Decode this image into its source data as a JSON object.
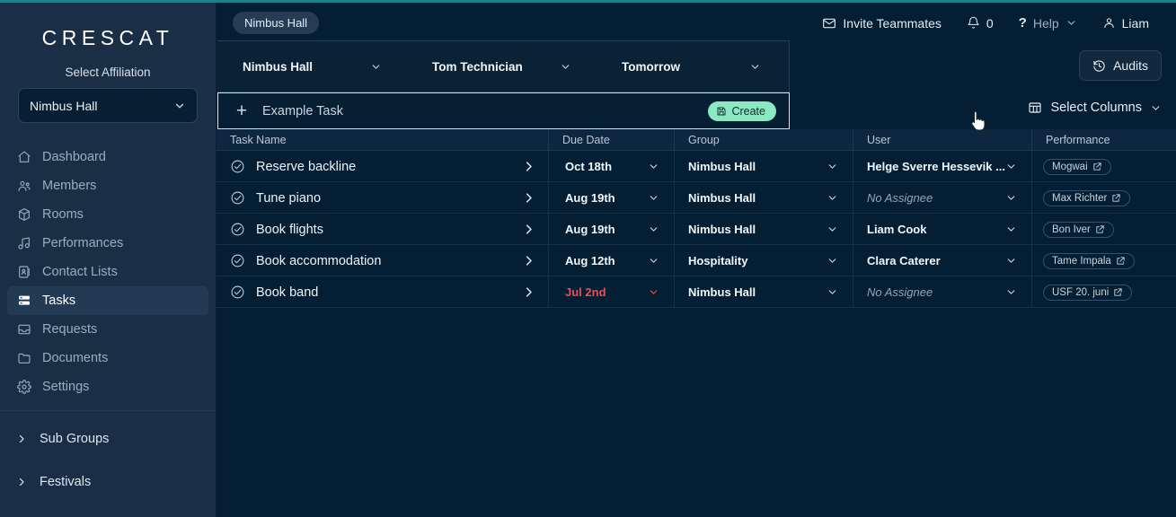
{
  "brand": "CRESCAT",
  "sidebar": {
    "affiliation_label": "Select Affiliation",
    "affiliation_value": "Nimbus Hall",
    "items": [
      {
        "label": "Dashboard",
        "icon": "home-icon",
        "active": false
      },
      {
        "label": "Members",
        "icon": "users-icon",
        "active": false
      },
      {
        "label": "Rooms",
        "icon": "cube-icon",
        "active": false
      },
      {
        "label": "Performances",
        "icon": "music-icon",
        "active": false
      },
      {
        "label": "Contact Lists",
        "icon": "contact-card-icon",
        "active": false
      },
      {
        "label": "Tasks",
        "icon": "tasks-icon",
        "active": true
      },
      {
        "label": "Requests",
        "icon": "inbox-icon",
        "active": false
      },
      {
        "label": "Documents",
        "icon": "folder-icon",
        "active": false
      },
      {
        "label": "Settings",
        "icon": "gear-icon",
        "active": false
      }
    ],
    "groups": [
      {
        "label": "Sub Groups",
        "icon": "chevron-right-icon"
      },
      {
        "label": "Festivals",
        "icon": "chevron-right-icon"
      }
    ]
  },
  "header": {
    "context_chip": "Nimbus Hall",
    "invite": "Invite Teammates",
    "notifications_count": "0",
    "help": "Help",
    "user": "Liam",
    "audits": "Audits"
  },
  "toolbar": {
    "select_columns": "Select Columns"
  },
  "filters": [
    {
      "value": "Nimbus Hall"
    },
    {
      "value": "Tom Technician"
    },
    {
      "value": "Tomorrow"
    }
  ],
  "new_task": {
    "placeholder": "Example Task",
    "value": "",
    "create_label": "Create"
  },
  "table": {
    "columns": [
      "Task Name",
      "Due Date",
      "Group",
      "User",
      "Performance"
    ],
    "rows": [
      {
        "task": "Reserve backline",
        "due": "Oct 18th",
        "overdue": false,
        "group": "Nimbus Hall",
        "user": "Helge Sverre Hessevik ...",
        "assigned": true,
        "performance": "Mogwai"
      },
      {
        "task": "Tune piano",
        "due": "Aug 19th",
        "overdue": false,
        "group": "Nimbus Hall",
        "user": "No Assignee",
        "assigned": false,
        "performance": "Max Richter"
      },
      {
        "task": "Book flights",
        "due": "Aug 19th",
        "overdue": false,
        "group": "Nimbus Hall",
        "user": "Liam Cook",
        "assigned": true,
        "performance": "Bon Iver"
      },
      {
        "task": "Book accommodation",
        "due": "Aug 12th",
        "overdue": false,
        "group": "Hospitality",
        "user": "Clara Caterer",
        "assigned": true,
        "performance": "Tame Impala"
      },
      {
        "task": "Book band",
        "due": "Jul 2nd",
        "overdue": true,
        "group": "Nimbus Hall",
        "user": "No Assignee",
        "assigned": false,
        "performance": "USF 20. juni"
      }
    ]
  },
  "colors": {
    "accent": "#1d7e8c",
    "sidebar_bg": "#1a2e45",
    "main_bg": "#041f34",
    "create_green": "#8ce8c2",
    "overdue_red": "#ef4d56"
  }
}
